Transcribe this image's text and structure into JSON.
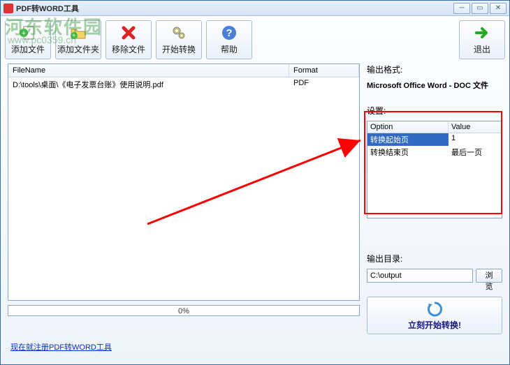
{
  "title": "PDF转WORD工具",
  "toolbar": {
    "add_file": "添加文件",
    "add_folder": "添加文件夹",
    "remove_file": "移除文件",
    "start_convert": "开始转换",
    "help": "帮助",
    "exit": "退出"
  },
  "file_table": {
    "headers": {
      "filename": "FileName",
      "format": "Format"
    },
    "rows": [
      {
        "name": "D:\\tools\\桌面\\《电子发票台账》使用说明.pdf",
        "format": "PDF"
      }
    ]
  },
  "progress": {
    "percent": "0%"
  },
  "right": {
    "output_format_label": "输出格式:",
    "output_format_value": "Microsoft Office Word - DOC 文件",
    "settings_label": "设置:",
    "settings_headers": {
      "option": "Option",
      "value": "Value"
    },
    "settings_rows": [
      {
        "option": "转换起始页",
        "value": "1",
        "selected": true
      },
      {
        "option": "转换结束页",
        "value": "最后一页",
        "selected": false
      }
    ],
    "output_dir_label": "输出目录:",
    "output_dir_value": "C:\\output",
    "browse_label": "浏览",
    "start_now": "立刻开始转换!"
  },
  "footer": {
    "register_link": "现在就注册PDF转WORD工具"
  },
  "watermark": {
    "text": "河东软件园",
    "url": "www.pc0359.cn"
  }
}
